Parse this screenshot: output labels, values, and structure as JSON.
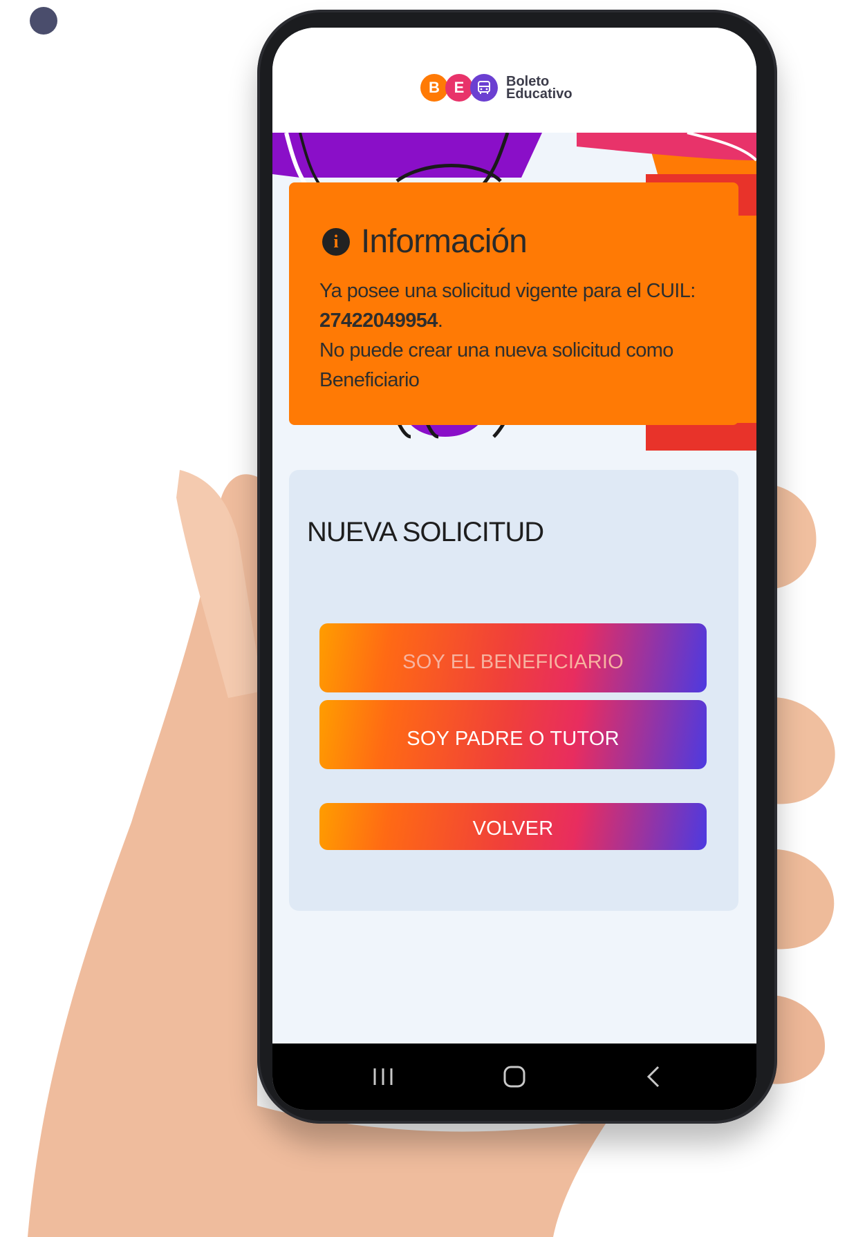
{
  "logo": {
    "letters": [
      "B",
      "E"
    ],
    "text_line1": "Boleto",
    "text_line2": "Educativo",
    "colors": [
      "#ff7a05",
      "#e8336a",
      "#6b3fd1"
    ]
  },
  "info": {
    "icon": "info-icon",
    "title": "Información",
    "line1": "Ya posee una solicitud vigente para el CUIL:",
    "cuil": "27422049954",
    "after_cuil": ".",
    "line2": "No puede crear una nueva solicitud como Beneficiario",
    "background": "#ff7a05"
  },
  "card": {
    "title": "NUEVA SOLICITUD",
    "buttons": {
      "beneficiario": "SOY EL BENEFICIARIO",
      "padre_tutor": "SOY PADRE O TUTOR",
      "volver": "VOLVER"
    }
  },
  "navbar": {
    "icons": [
      "recents-icon",
      "home-icon",
      "back-icon"
    ]
  }
}
